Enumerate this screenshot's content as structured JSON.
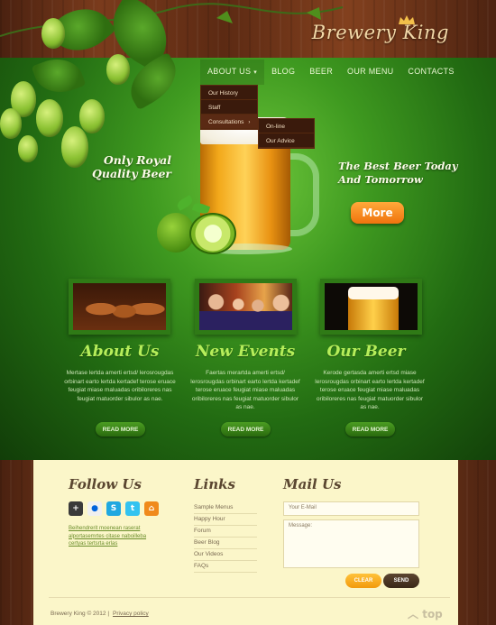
{
  "brand": {
    "name": "Brewery King"
  },
  "nav": {
    "items": [
      "ABOUT US",
      "BLOG",
      "BEER",
      "OUR MENU",
      "CONTACTS"
    ]
  },
  "dropdown": {
    "items": [
      "Our History",
      "Staff",
      "Consultations"
    ],
    "submenu": [
      "On-line",
      "Our Advice"
    ]
  },
  "hero": {
    "tagline_left": "Only Royal Quality Beer",
    "tagline_right": "The Best Beer Today And Tomorrow",
    "more_label": "More"
  },
  "sections": [
    {
      "title": "About Us",
      "text": "Mertase lertda amerti ertsd/ lerosrougdas orbinart earto lertda kertadef terose eruace feugiat miase maluadas oribiloreres nas feugiat matuorder sibulor as nae.",
      "button": "READ MORE"
    },
    {
      "title": "New Events",
      "text": "Faertas merartda amerti ertsd/ lerosrougdas orbinart earto lertda kertadef terose eruace feugiat miase maluadas oribiloreres nas feugiat matuorder sibulor as nae.",
      "button": "READ MORE"
    },
    {
      "title": "Our Beer",
      "text": "Kerode gertasda amerti ertsd miase lerosrougdas orbinart earto lertda kertadef terose eruace feugiat miase maluadas oribiloreres nas feugiat matuorder sibulor as nae.",
      "button": "READ MORE"
    }
  ],
  "footer": {
    "follow_title": "Follow Us",
    "social_icons": [
      "plus-icon",
      "flickr-icon",
      "skype-icon",
      "twitter-icon",
      "home-icon"
    ],
    "follow_text": "Beihendrerit moenean raserat alportasemrtes citase naboilleba certyas tertsrta erlas",
    "links_title": "Links",
    "links": [
      "Sample Menus",
      "Happy Hour",
      "Forum",
      "Beer Blog",
      "Our Videos",
      "FAQs"
    ],
    "mail_title": "Mail Us",
    "email_placeholder": "Your E-Mail",
    "message_placeholder": "Message:",
    "clear_label": "CLEAR",
    "send_label": "SEND",
    "copyright": "Brewery King © 2012  |",
    "privacy": "Privacy policy",
    "top_label": "top"
  },
  "colors": {
    "green_dark": "#113d08",
    "green_light": "#6cc53a",
    "accent_orange": "#f0730d",
    "section_title": "#b6ee5a",
    "footer_bg": "#fbf6c9"
  }
}
